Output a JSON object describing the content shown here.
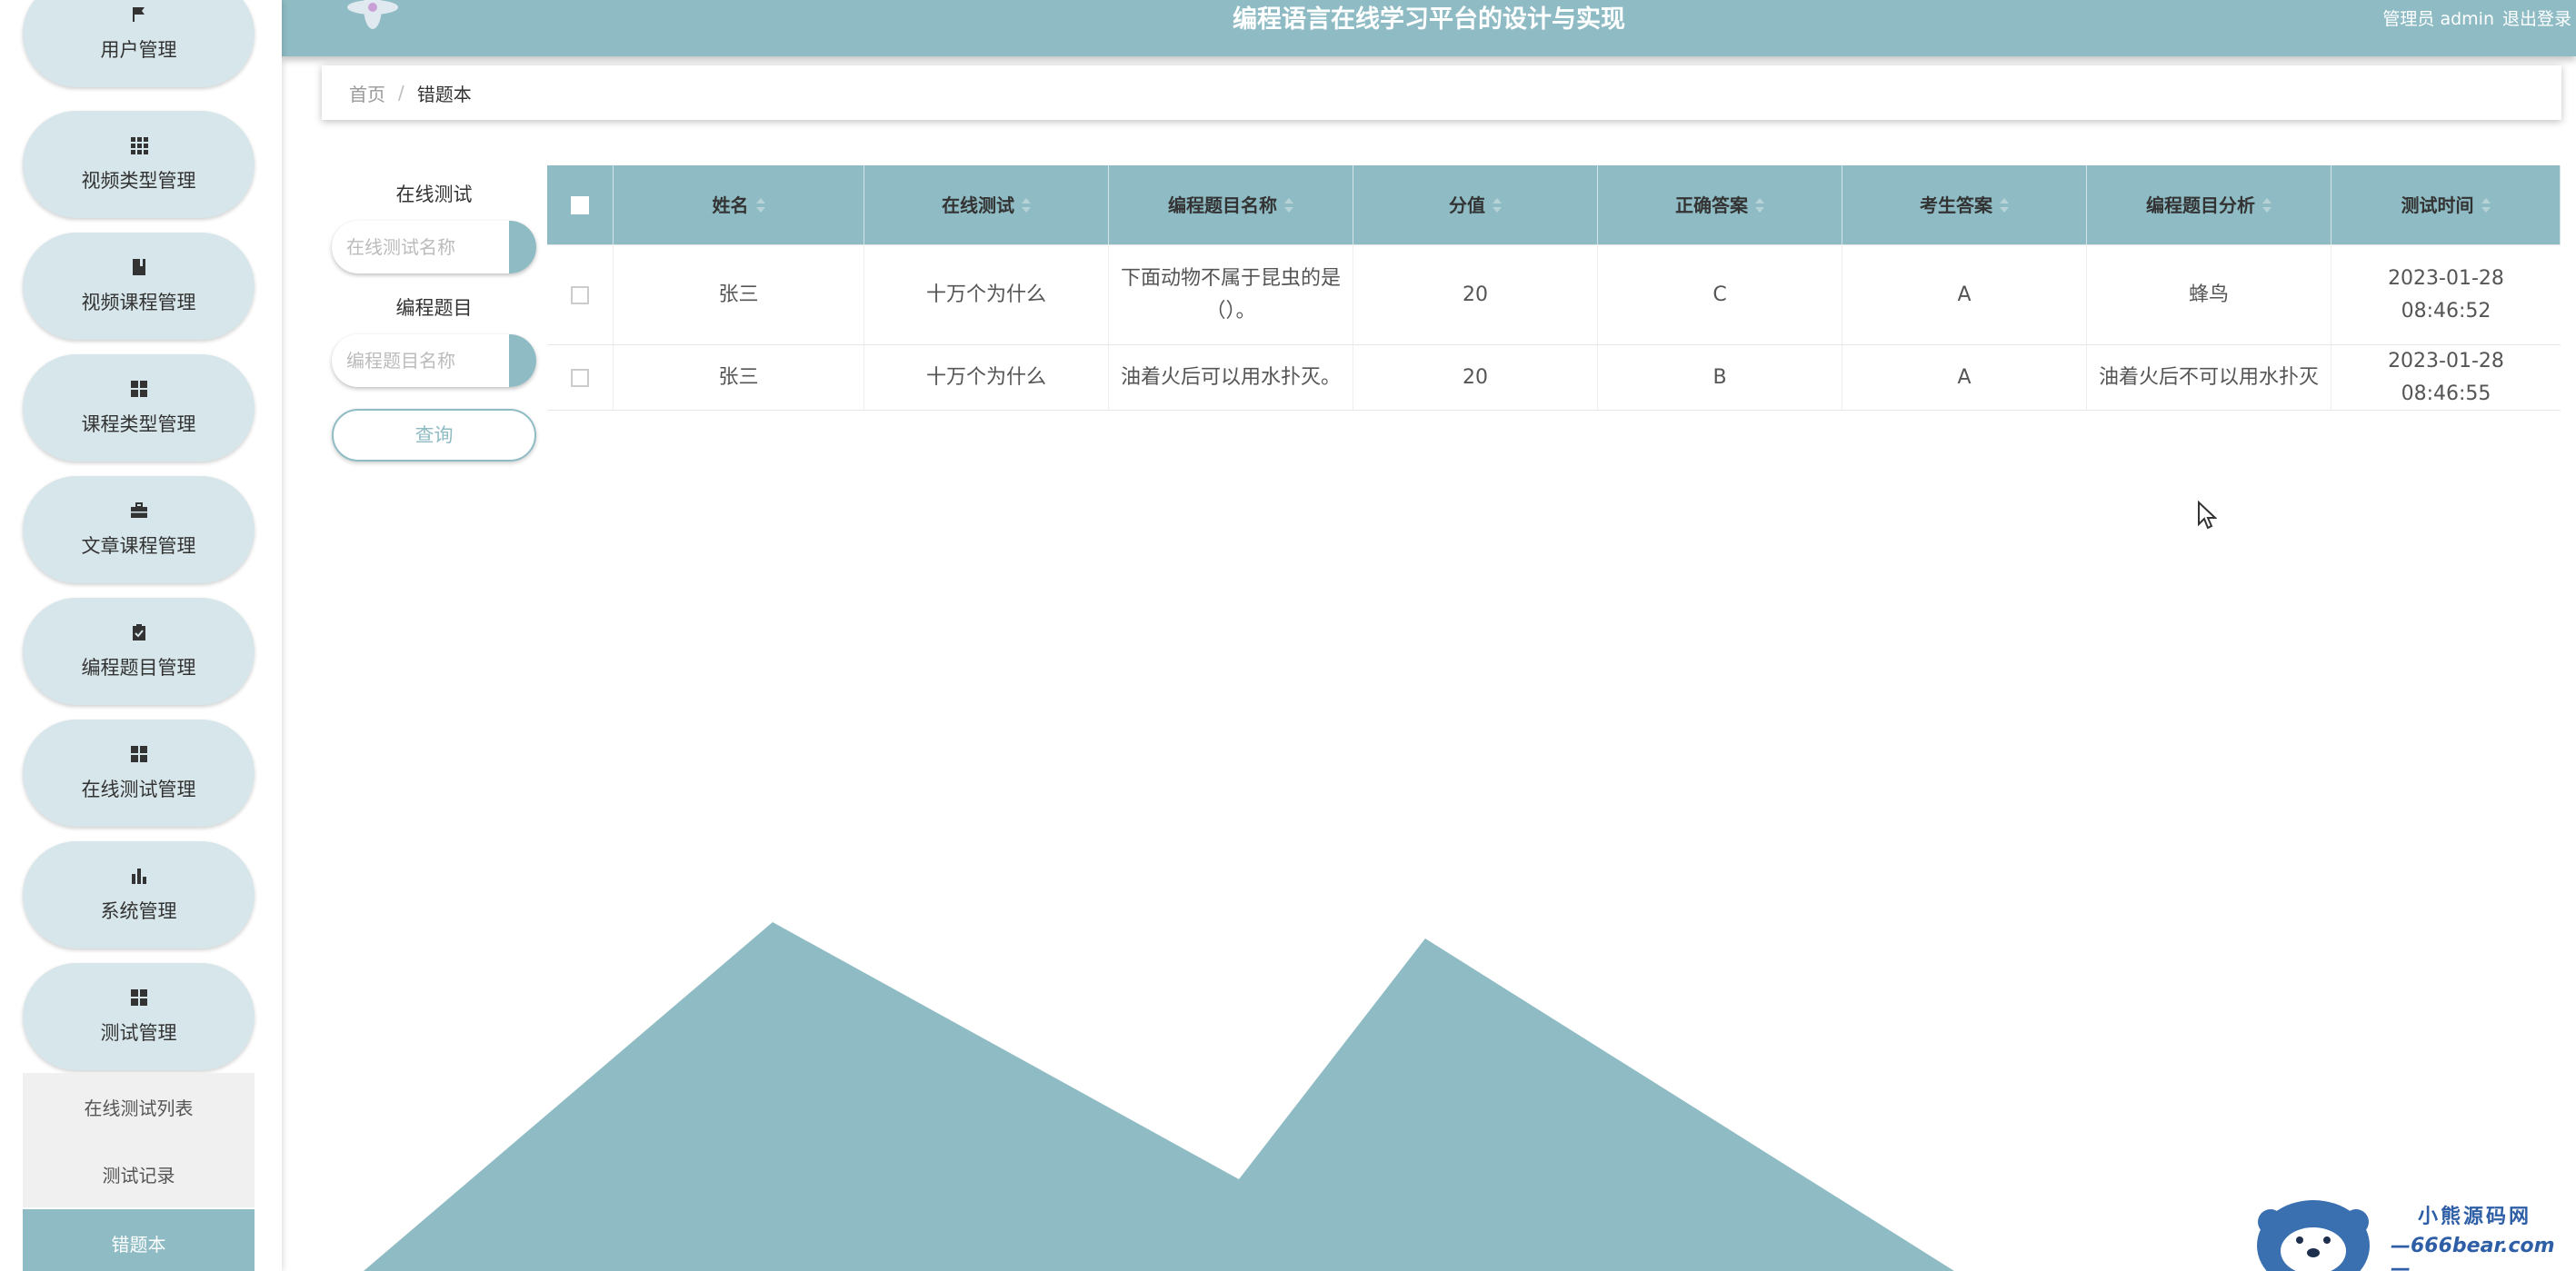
{
  "header": {
    "title": "编程语言在线学习平台的设计与实现",
    "admin_label": "管理员 admin",
    "logout_label": "退出登录"
  },
  "sidebar": {
    "items": [
      {
        "label": "用户管理",
        "icon": "flag-icon"
      },
      {
        "label": "视频类型管理",
        "icon": "grid-icon"
      },
      {
        "label": "视频课程管理",
        "icon": "book-icon"
      },
      {
        "label": "课程类型管理",
        "icon": "apps-icon"
      },
      {
        "label": "文章课程管理",
        "icon": "briefcase-icon"
      },
      {
        "label": "编程题目管理",
        "icon": "clipboard-check-icon"
      },
      {
        "label": "在线测试管理",
        "icon": "apps-icon"
      },
      {
        "label": "系统管理",
        "icon": "bar-chart-icon"
      },
      {
        "label": "测试管理",
        "icon": "apps-icon"
      }
    ],
    "subitems": [
      {
        "label": "在线测试列表"
      },
      {
        "label": "测试记录"
      },
      {
        "label": "错题本"
      }
    ]
  },
  "breadcrumb": {
    "home": "首页",
    "separator": "/",
    "current": "错题本"
  },
  "search": {
    "test_label": "在线测试",
    "test_placeholder": "在线测试名称",
    "question_label": "编程题目",
    "question_placeholder": "编程题目名称",
    "query_button": "查询"
  },
  "table": {
    "columns": [
      "姓名",
      "在线测试",
      "编程题目名称",
      "分值",
      "正确答案",
      "考生答案",
      "编程题目分析",
      "测试时间"
    ],
    "rows": [
      {
        "name": "张三",
        "test": "十万个为什么",
        "question": "下面动物不属于昆虫的是（）。",
        "score": "20",
        "correct": "C",
        "answer": "A",
        "analysis": "蜂鸟",
        "time": "2023-01-28 08:46:52"
      },
      {
        "name": "张三",
        "test": "十万个为什么",
        "question": "油着火后可以用水扑灭。",
        "score": "20",
        "correct": "B",
        "answer": "A",
        "analysis": "油着火后不可以用水扑灭",
        "time": "2023-01-28 08:46:55"
      }
    ]
  },
  "watermark": {
    "line1": "小熊源码网",
    "line2": "—666bear.com—"
  },
  "colors": {
    "accent": "#8fbcc4",
    "nav_bg": "#d7e6ea",
    "mountain": "#8fbcc4"
  }
}
